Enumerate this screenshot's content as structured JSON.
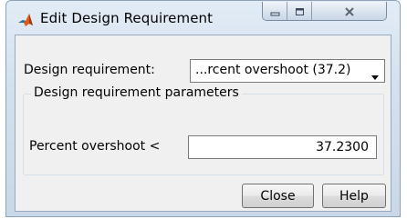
{
  "window": {
    "title": "Edit Design Requirement",
    "icons": {
      "app": "matlab-logo-icon",
      "minimize": "minimize-icon",
      "maximize": "maximize-icon",
      "close": "close-icon"
    }
  },
  "form": {
    "design_requirement_label": "Design requirement:",
    "design_requirement_value": "...rcent overshoot (37.2)",
    "group_title": "Design requirement parameters",
    "percent_overshoot_label": "Percent overshoot <",
    "percent_overshoot_value": "37.2300"
  },
  "buttons": {
    "close_label": "Close",
    "help_label": "Help"
  },
  "colors": {
    "title_bar": "#d3e0ee",
    "client_background": "#f0f0f0",
    "matlab_orange": "#e05a1a",
    "matlab_blue": "#2a6fa8"
  }
}
